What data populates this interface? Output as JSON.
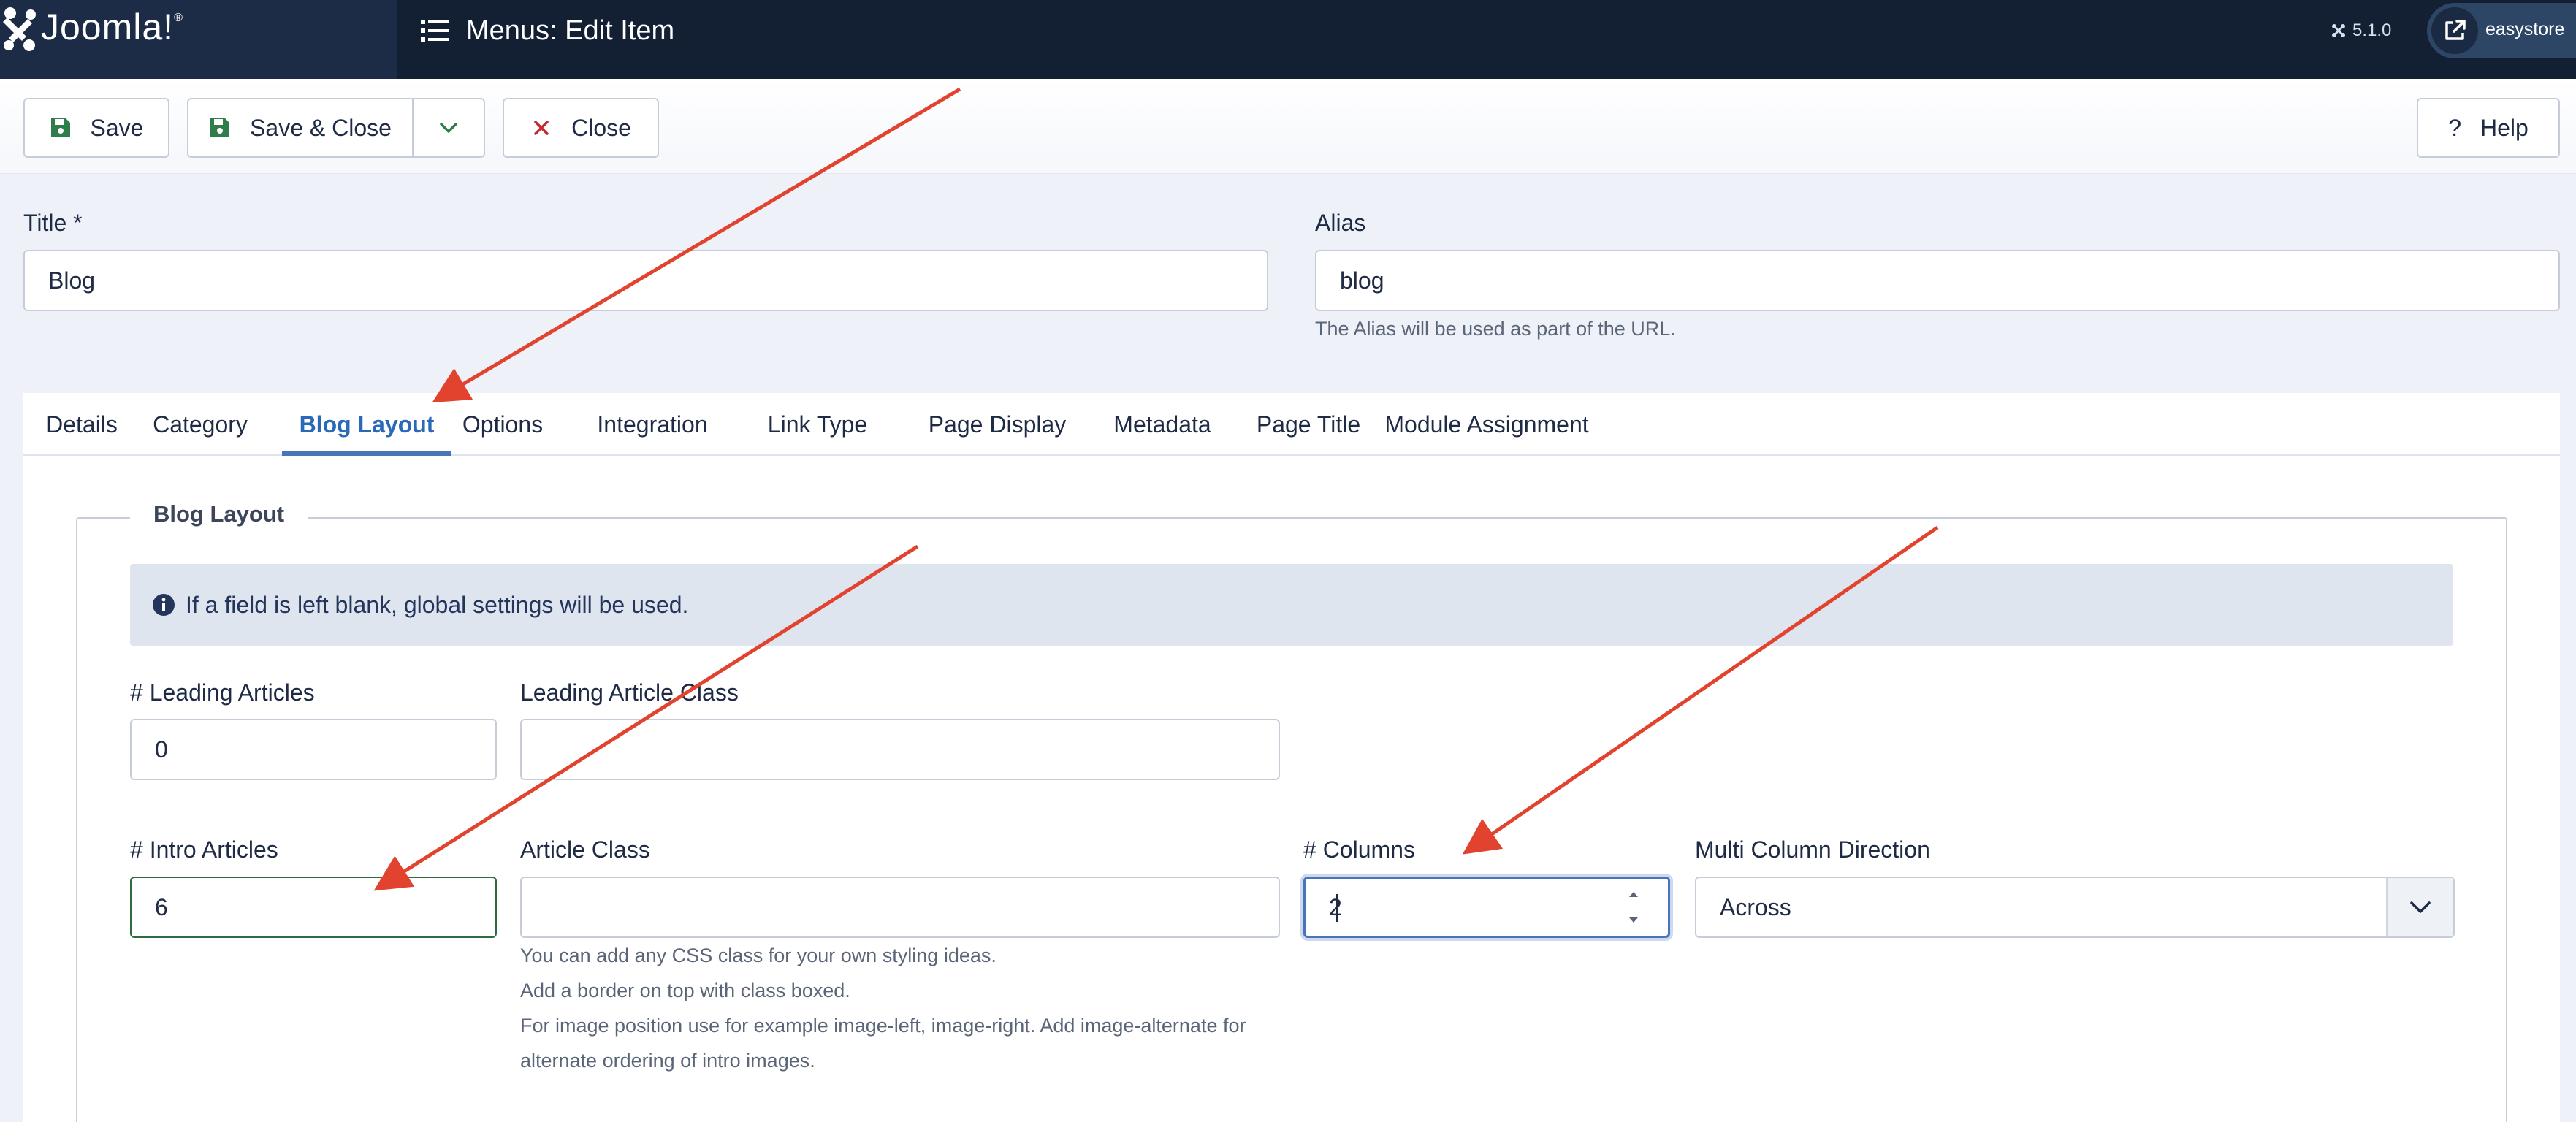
{
  "header": {
    "logo_text": "Joomla!",
    "logo_reg": "®",
    "page_title": "Menus: Edit Item",
    "version": "5.1.0",
    "site_name": "easystore"
  },
  "toolbar": {
    "save_label": "Save",
    "save_close_label": "Save & Close",
    "close_label": "Close",
    "help_label": "Help"
  },
  "form": {
    "title_label": "Title *",
    "title_value": "Blog",
    "alias_label": "Alias",
    "alias_value": "blog",
    "alias_hint": "The Alias will be used as part of the URL."
  },
  "tabs": [
    {
      "label": "Details"
    },
    {
      "label": "Category"
    },
    {
      "label": "Blog Layout"
    },
    {
      "label": "Options"
    },
    {
      "label": "Integration"
    },
    {
      "label": "Link Type"
    },
    {
      "label": "Page Display"
    },
    {
      "label": "Metadata"
    },
    {
      "label": "Page Title"
    },
    {
      "label": "Module Assignment"
    }
  ],
  "active_tab": "Blog Layout",
  "blog_layout": {
    "legend": "Blog Layout",
    "alert": "If a field is left blank, global settings will be used.",
    "leading_articles_label": "# Leading Articles",
    "leading_articles_value": "0",
    "leading_class_label": "Leading Article Class",
    "leading_class_value": "",
    "intro_articles_label": "# Intro Articles",
    "intro_articles_value": "6",
    "article_class_label": "Article Class",
    "article_class_value": "",
    "article_class_hint_1": "You can add any CSS class for your own styling ideas.",
    "article_class_hint_2": "Add a border on top with class boxed.",
    "article_class_hint_3": "For image position use for example image-left, image-right. Add image-alternate for",
    "article_class_hint_4": "alternate ordering of intro images.",
    "columns_label": "# Columns",
    "columns_value": "2",
    "direction_label": "Multi Column Direction",
    "direction_value": "Across"
  },
  "colors": {
    "header_bg": "#132034",
    "accent": "#4a74b8",
    "save_icon": "#2f7d4a",
    "close_icon": "#c5282f",
    "annotation_arrow": "#e2432f"
  }
}
